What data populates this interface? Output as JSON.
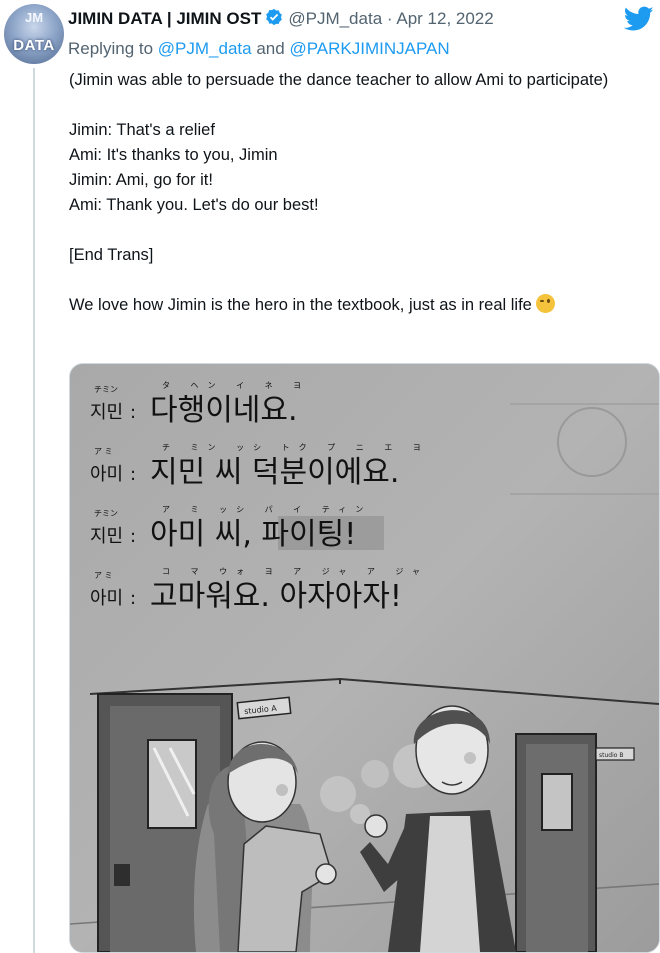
{
  "tweet": {
    "author_name": "JIMIN DATA | JIMIN OST",
    "handle": "@PJM_data",
    "separator": "·",
    "date": "Apr 12, 2022",
    "avatar_text": "DATA",
    "avatar_top_text": "JM",
    "replying_prefix": "Replying to",
    "replying_user1": "@PJM_data",
    "replying_and": "and",
    "replying_user2": "@PARKJIMINJAPAN",
    "lines": [
      "(Jimin was able to persuade the dance teacher to allow Ami to participate)",
      "Jimin: That's a relief",
      "Ami: It's thanks to you, Jimin",
      "Jimin: Ami, go for it!",
      "Ami: Thank you. Let's do our best!",
      "[End Trans]",
      "We love how Jimin is the hero in the textbook, just as in real life"
    ],
    "emoji": "winking-face"
  },
  "image": {
    "dialogue": [
      {
        "ruby_speaker": "チミン",
        "speaker": "지민",
        "ruby_line": "タ ヘン イ ネ ヨ",
        "line": "다행이네요."
      },
      {
        "ruby_speaker": "ア ミ",
        "speaker": "아미",
        "ruby_line": "チ ミン ッシ トク プ ニ エ ヨ",
        "line": "지민 씨 덕분이에요."
      },
      {
        "ruby_speaker": "チミン",
        "speaker": "지민",
        "ruby_line": "ア ミ ッシ パ イ ティン",
        "line": "아미 씨, 파이팅!"
      },
      {
        "ruby_speaker": "ア ミ",
        "speaker": "아미",
        "ruby_line": "コ マ ウォ ヨ ア ジャ ア ジャ",
        "line": "고마워요. 아자아자!"
      }
    ],
    "colon": ":",
    "door_sign_a": "studio A",
    "door_sign_b": "studio B"
  },
  "colors": {
    "verified": "#1d9bf0",
    "twitter": "#1d9bf0",
    "link": "#1d9bf0",
    "secondary_text": "#536471"
  },
  "icons": {
    "verified": "verified-badge-icon",
    "twitter": "twitter-bird-icon"
  }
}
